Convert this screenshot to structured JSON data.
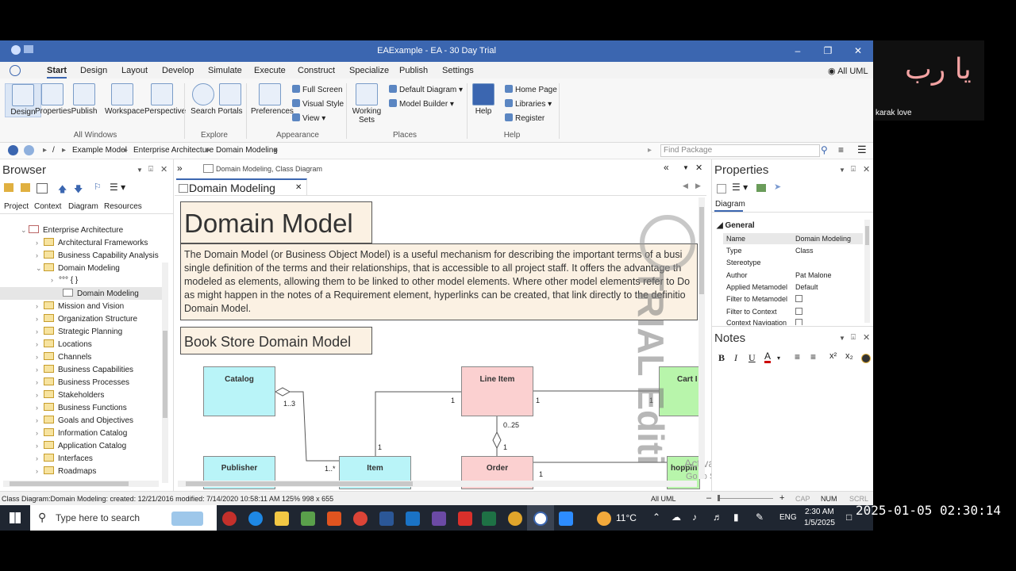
{
  "window": {
    "title": "EAExample - EA - 30 Day Trial"
  },
  "menu": [
    "Start",
    "Design",
    "Layout",
    "Develop",
    "Simulate",
    "Execute",
    "Construct",
    "Specialize",
    "Publish",
    "Settings"
  ],
  "menu_right": "All UML",
  "ribbon": {
    "design": "Design",
    "properties": "Properties",
    "publish": "Publish",
    "workspace": "Workspace",
    "perspective": "Perspective",
    "search": "Search",
    "portals": "Portals",
    "preferences": "Preferences",
    "full_screen": "Full Screen",
    "visual_style": "Visual Style",
    "view": "View",
    "working_sets": "Working Sets",
    "default_diagram": "Default Diagram",
    "model_builder": "Model Builder",
    "help": "Help",
    "home_page": "Home Page",
    "libraries": "Libraries",
    "register": "Register",
    "groups": {
      "all_windows": "All Windows",
      "explore": "Explore",
      "appearance": "Appearance",
      "places": "Places",
      "help": "Help"
    }
  },
  "breadcrumb": [
    "/",
    "Example Model",
    "Enterprise Architecture",
    "Domain Modeling"
  ],
  "find_package": {
    "placeholder": "Find Package"
  },
  "browser": {
    "title": "Browser",
    "tabs": [
      "Project",
      "Context",
      "Diagram",
      "Resources"
    ],
    "items": [
      "Enterprise Architecture",
      "Architectural Frameworks",
      "Business Capability Analysis",
      "Domain Modeling",
      "°°° { }",
      "Domain Modeling",
      "Mission and Vision",
      "Organization Structure",
      "Strategic Planning",
      "Locations",
      "Channels",
      "Business Capabilities",
      "Business Processes",
      "Stakeholders",
      "Business Functions",
      "Goals and Objectives",
      "Information Catalog",
      "Application Catalog",
      "Interfaces",
      "Roadmaps"
    ]
  },
  "diagram": {
    "path": "Domain Modeling,  Class Diagram",
    "tab": "Domain Modeling",
    "heading": "Domain Model",
    "description": "The Domain Model (or Business Object Model) is a useful mechanism for describing the important terms of a busi single definition of the terms and their relationships, that is accessible to all project staff.  It offers the advantage th modeled as elements, allowing them to be linked to other model elements. Where other model elements refer to Do as might happen in the notes of  a Requirement element, hyperlinks can be created, that link directly to the definitio Domain Model.",
    "subheading": "Book Store Domain Model",
    "classes": [
      "Catalog",
      "Line Item",
      "Cart I",
      "Publisher",
      "Item",
      "Order",
      "hoppin"
    ],
    "multiplicities": [
      "1..3",
      "1",
      "1",
      "1",
      "0..25",
      "1",
      "1",
      "1..*",
      "1"
    ],
    "watermark": "TRIAL Editi",
    "activate": [
      "Activate Windows",
      "Go to Settings to activate Windows."
    ]
  },
  "properties": {
    "title": "Properties",
    "tab": "Diagram",
    "section": "General",
    "rows": [
      {
        "k": "Name",
        "v": "Domain Modeling"
      },
      {
        "k": "Type",
        "v": "Class"
      },
      {
        "k": "Stereotype",
        "v": ""
      },
      {
        "k": "Author",
        "v": "Pat Malone"
      },
      {
        "k": "Applied Metamodel",
        "v": "Default"
      },
      {
        "k": "Filter to Metamodel",
        "v": ""
      },
      {
        "k": "Filter to Context",
        "v": ""
      },
      {
        "k": "Context Navigation",
        "v": ""
      }
    ]
  },
  "notes": {
    "title": "Notes"
  },
  "status": {
    "left": "Class Diagram:Domain Modeling:   created: 12/21/2016  modified: 7/14/2020 10:58:11 AM   125%   998 x 655",
    "mid": "All UML",
    "keys": [
      "CAP",
      "NUM",
      "SCRL"
    ]
  },
  "taskbar": {
    "search_placeholder": "Type here to search",
    "weather": "11°C",
    "lang": "ENG",
    "time": "2:30 AM",
    "date": "1/5/2025"
  },
  "overlay": {
    "arabic": "يا رب",
    "caption": "karak love",
    "timestamp": "2025-01-05 02:30:14"
  }
}
